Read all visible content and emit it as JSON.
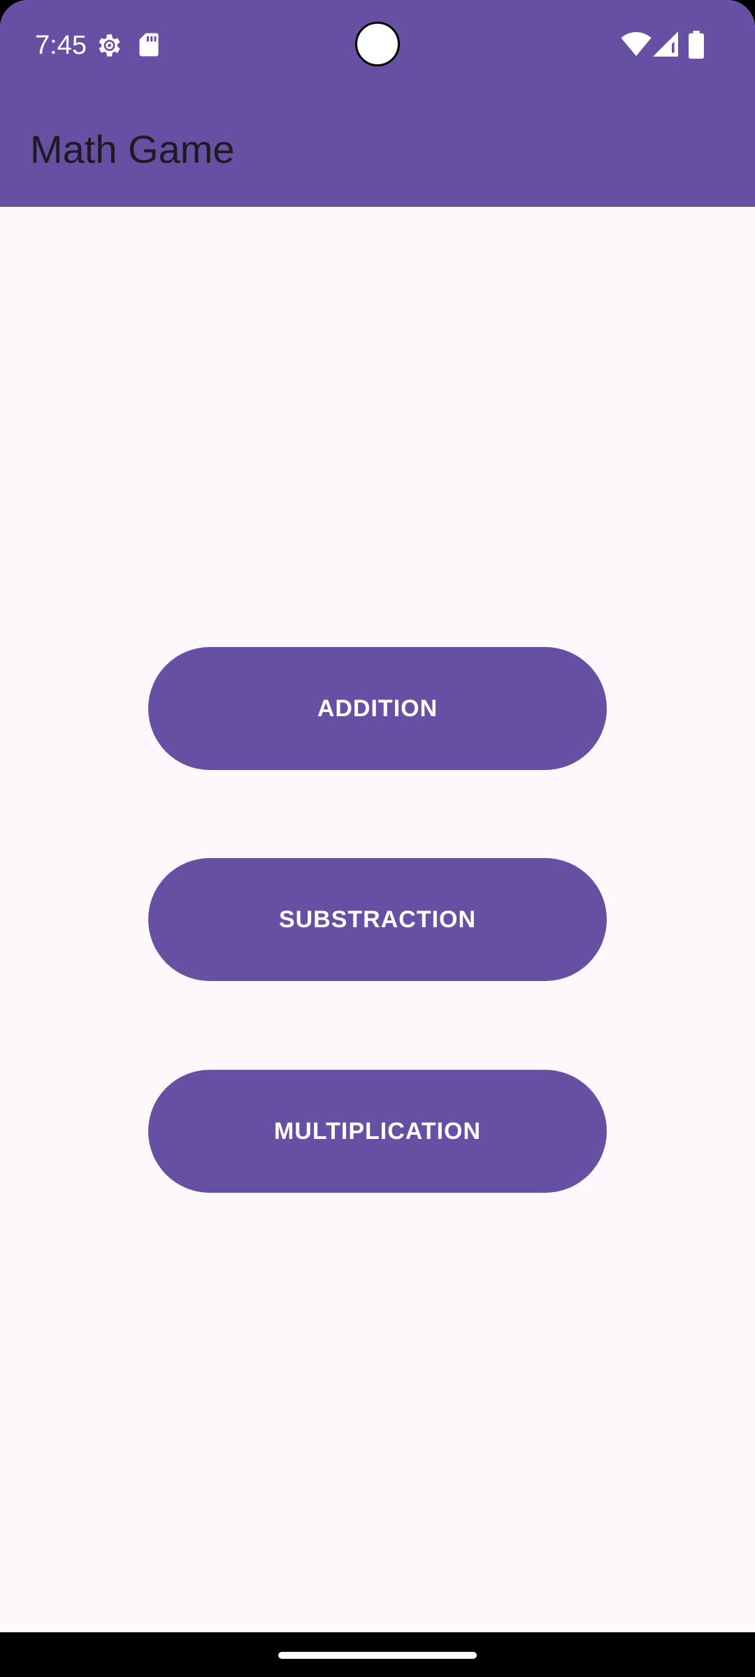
{
  "status_bar": {
    "time": "7:45",
    "icons": [
      "settings-gear-icon",
      "sd-card-icon",
      "wifi-icon",
      "cellular-signal-icon",
      "battery-icon"
    ]
  },
  "app_bar": {
    "title": "Math Game"
  },
  "menu": {
    "buttons": [
      {
        "label": "ADDITION"
      },
      {
        "label": "SUBSTRACTION"
      },
      {
        "label": "MULTIPLICATION"
      }
    ]
  },
  "colors": {
    "primary": "#6750A4",
    "background": "#FDF8FC",
    "on_primary": "#FFFFFF",
    "title_text": "#1D1B20"
  }
}
